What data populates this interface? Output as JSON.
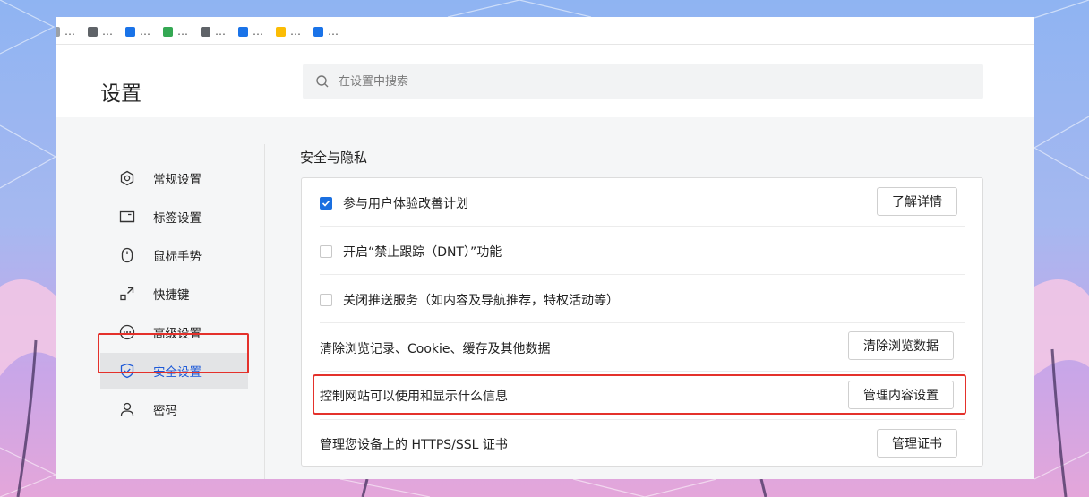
{
  "bookmarks": [
    {
      "label": "…",
      "color": "#9aa0a6"
    },
    {
      "label": "…",
      "color": "#5f6368"
    },
    {
      "label": "…",
      "color": "#1a73e8"
    },
    {
      "label": "…",
      "color": "#34a853"
    },
    {
      "label": "…",
      "color": "#5f6368"
    },
    {
      "label": "…",
      "color": "#1a73e8"
    },
    {
      "label": "…",
      "color": "#fbbc04"
    },
    {
      "label": "…",
      "color": "#1a73e8"
    }
  ],
  "header": {
    "title": "设置",
    "search_placeholder": "在设置中搜索"
  },
  "sidebar": {
    "items": [
      {
        "label": "常规设置",
        "icon": "gear-icon"
      },
      {
        "label": "标签设置",
        "icon": "tab-icon"
      },
      {
        "label": "鼠标手势",
        "icon": "mouse-icon"
      },
      {
        "label": "快捷键",
        "icon": "shortcut-icon"
      },
      {
        "label": "高级设置",
        "icon": "more-icon"
      },
      {
        "label": "安全设置",
        "icon": "shield-icon",
        "active": true
      },
      {
        "label": "密码",
        "icon": "user-icon"
      }
    ]
  },
  "section": {
    "title": "安全与隐私",
    "rows": {
      "ux_plan": {
        "label": "参与用户体验改善计划",
        "checked": true,
        "button": "了解详情"
      },
      "dnt": {
        "label": "开启“禁止跟踪（DNT）”功能",
        "checked": false
      },
      "push": {
        "label": "关闭推送服务（如内容及导航推荐，特权活动等）",
        "checked": false
      },
      "clear": {
        "label": "清除浏览记录、Cookie、缓存及其他数据",
        "button": "清除浏览数据"
      },
      "content": {
        "label": "控制网站可以使用和显示什么信息",
        "button": "管理内容设置"
      },
      "cert": {
        "label": "管理您设备上的 HTTPS/SSL 证书",
        "button": "管理证书"
      }
    }
  },
  "colors": {
    "accent": "#1a6fe0",
    "highlight": "#e4312b"
  }
}
